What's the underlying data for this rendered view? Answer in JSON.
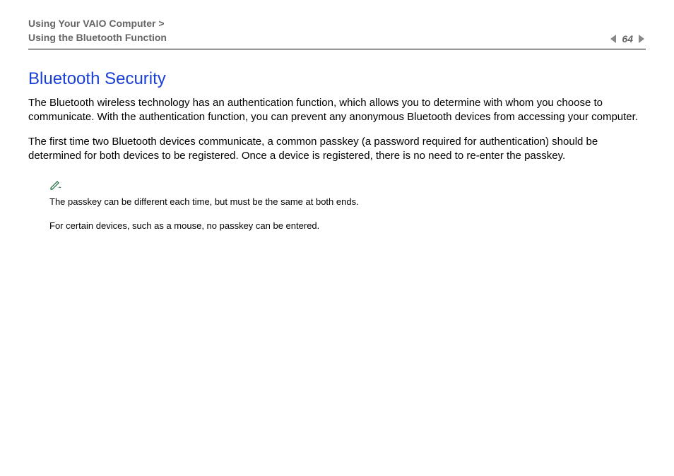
{
  "header": {
    "breadcrumb_line1": "Using Your VAIO Computer >",
    "breadcrumb_line2": "Using the Bluetooth Function",
    "page_number": "64"
  },
  "content": {
    "title": "Bluetooth Security",
    "paragraph1": "The Bluetooth wireless technology has an authentication function, which allows you to determine with whom you choose to communicate. With the authentication function, you can prevent any anonymous Bluetooth devices from accessing your computer.",
    "paragraph2": "The first time two Bluetooth devices communicate, a common passkey (a password required for authentication) should be determined for both devices to be registered. Once a device is registered, there is no need to re-enter the passkey.",
    "note1": "The passkey can be different each time, but must be the same at both ends.",
    "note2": "For certain devices, such as a mouse, no passkey can be entered."
  }
}
